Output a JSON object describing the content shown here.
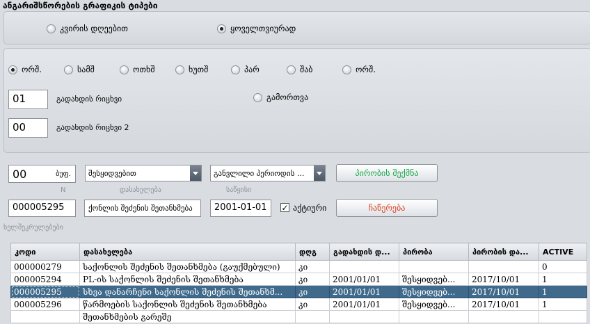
{
  "section_title": "ანგარიშსწორების გრაფიკის ტიპები",
  "schedule_type": {
    "options": [
      "კვირის დღეებით",
      "ყოველთვიურად"
    ],
    "selected": 1
  },
  "weekdays": {
    "options": [
      "ორშ.",
      "სამშ",
      "ოთხშ",
      "ხუთშ",
      "პარ",
      "შაბ",
      "ორშ."
    ],
    "selected": 0
  },
  "payment_number": {
    "value": "01",
    "label": "გადახდის რიცხვი"
  },
  "payment_number2": {
    "value": "00",
    "label": "გადახდის რიცხვი 2"
  },
  "disable_label": "გამორთვა",
  "condition": {
    "days_value": "00",
    "days_suffix": "ბუფ.",
    "combo1": "შესყიდვებით",
    "combo2": "განვლილი პერიოდის ...",
    "create_button": "პირობის შექმნა",
    "hint_n": "N",
    "hint_name": "დასახელება",
    "hint_start": "საწყისი",
    "number_value": "000005295",
    "name_value": "ქონლის შეძენის შეთანხმება",
    "start_value": "2001-01-01",
    "active_label": "აქტიური",
    "record_button": "ჩაწერება"
  },
  "contracts_label": "ხელშეკრულებები",
  "table": {
    "headers": [
      "კოდი",
      "დასახელება",
      "დღგ",
      "გადახდის დ...",
      "პირობა",
      "პირობის და...",
      "ACTIVE"
    ],
    "rows": [
      [
        "000000279",
        "საქონლის შეძენის შეთანხმება (გაუქმებული)",
        "კი",
        "",
        "",
        "",
        "0"
      ],
      [
        "000005294",
        "PL-ის საქონლის შეძენის შეთანხმება",
        "კი",
        "2001/01/01",
        "შესყიდვებ...",
        "2017/10/01",
        "1"
      ],
      [
        "000005295",
        "სხვა დანარჩენი საქონლის შეძენის შეთანხმ...",
        "კი",
        "2001/01/01",
        "შესყიდვებ...",
        "2017/10/01",
        "1"
      ],
      [
        "000005296",
        "წარმოების საქონლის შეძენის შეთანხმება",
        "კი",
        "2001/01/01",
        "შესყიდვებ...",
        "2017/10/01",
        "1"
      ],
      [
        "",
        "შეთანხმების გარეშე",
        "",
        "",
        "",
        "",
        ""
      ]
    ],
    "selected_row": 2
  },
  "colors": {
    "create_text": "#1aa84a",
    "record_text": "#e0401f",
    "selection": "#3f6a8b"
  }
}
